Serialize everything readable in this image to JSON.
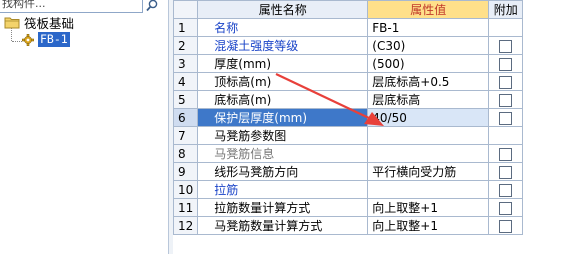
{
  "search": {
    "value": "找构件..."
  },
  "tree": {
    "root_label": "筏板基础",
    "child_label": "FB-1"
  },
  "grid": {
    "headers": {
      "num": "",
      "name": "属性名称",
      "value": "属性值",
      "attach": "附加"
    },
    "rows": [
      {
        "num": "1",
        "name": "名称",
        "value": "FB-1",
        "has_checkbox": false,
        "style": "blue"
      },
      {
        "num": "2",
        "name": "混凝土强度等级",
        "value": "(C30)",
        "has_checkbox": true,
        "style": "blue"
      },
      {
        "num": "3",
        "name": "厚度(mm)",
        "value": "(500)",
        "has_checkbox": true,
        "style": "normal"
      },
      {
        "num": "4",
        "name": "顶标高(m)",
        "value": "层底标高+0.5",
        "has_checkbox": true,
        "style": "normal"
      },
      {
        "num": "5",
        "name": "底标高(m)",
        "value": "层底标高",
        "has_checkbox": true,
        "style": "normal"
      },
      {
        "num": "6",
        "name": "保护层厚度(mm)",
        "value": "40/50",
        "has_checkbox": true,
        "style": "selected"
      },
      {
        "num": "7",
        "name": "马凳筋参数图",
        "value": "",
        "has_checkbox": false,
        "style": "normal"
      },
      {
        "num": "8",
        "name": "马凳筋信息",
        "value": "",
        "has_checkbox": true,
        "style": "gray"
      },
      {
        "num": "9",
        "name": "线形马凳筋方向",
        "value": "平行横向受力筋",
        "has_checkbox": true,
        "style": "normal"
      },
      {
        "num": "10",
        "name": "拉筋",
        "value": "",
        "has_checkbox": true,
        "style": "blue"
      },
      {
        "num": "11",
        "name": "拉筋数量计算方式",
        "value": "向上取整+1",
        "has_checkbox": true,
        "style": "normal"
      },
      {
        "num": "12",
        "name": "马凳筋数量计算方式",
        "value": "向上取整+1",
        "has_checkbox": true,
        "style": "normal"
      }
    ]
  },
  "colors": {
    "selected_row": "#3e78c9",
    "header_value_bg": "#ffe08a",
    "header_value_text": "#c0392b",
    "annotation_arrow": "#e8403a"
  },
  "icons": {
    "search": "search-icon",
    "folder": "folder-icon",
    "component": "gear-icon",
    "annotation": "arrow-annotation"
  }
}
